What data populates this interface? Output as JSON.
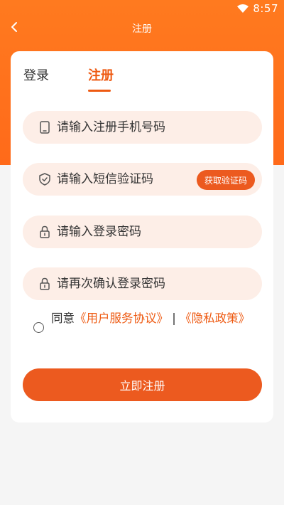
{
  "status_bar": {
    "time": "8:57"
  },
  "nav": {
    "title": "注册"
  },
  "tabs": [
    {
      "label": "登录",
      "active": false
    },
    {
      "label": "注册",
      "active": true
    }
  ],
  "fields": {
    "phone_placeholder": "请输入注册手机号码",
    "sms_placeholder": "请输入短信验证码",
    "get_code_label": "获取验证码",
    "password_placeholder": "请输入登录密码",
    "confirm_password_placeholder": "请再次确认登录密码"
  },
  "agreement": {
    "prefix": "同意",
    "link1": "《用户服务协议》",
    "separator": "|",
    "link2": "《隐私政策》",
    "checked": false
  },
  "submit_label": "立即注册",
  "colors": {
    "accent": "#ee5a12",
    "header": "#ff6a1a",
    "field_bg": "#fdeee7"
  }
}
